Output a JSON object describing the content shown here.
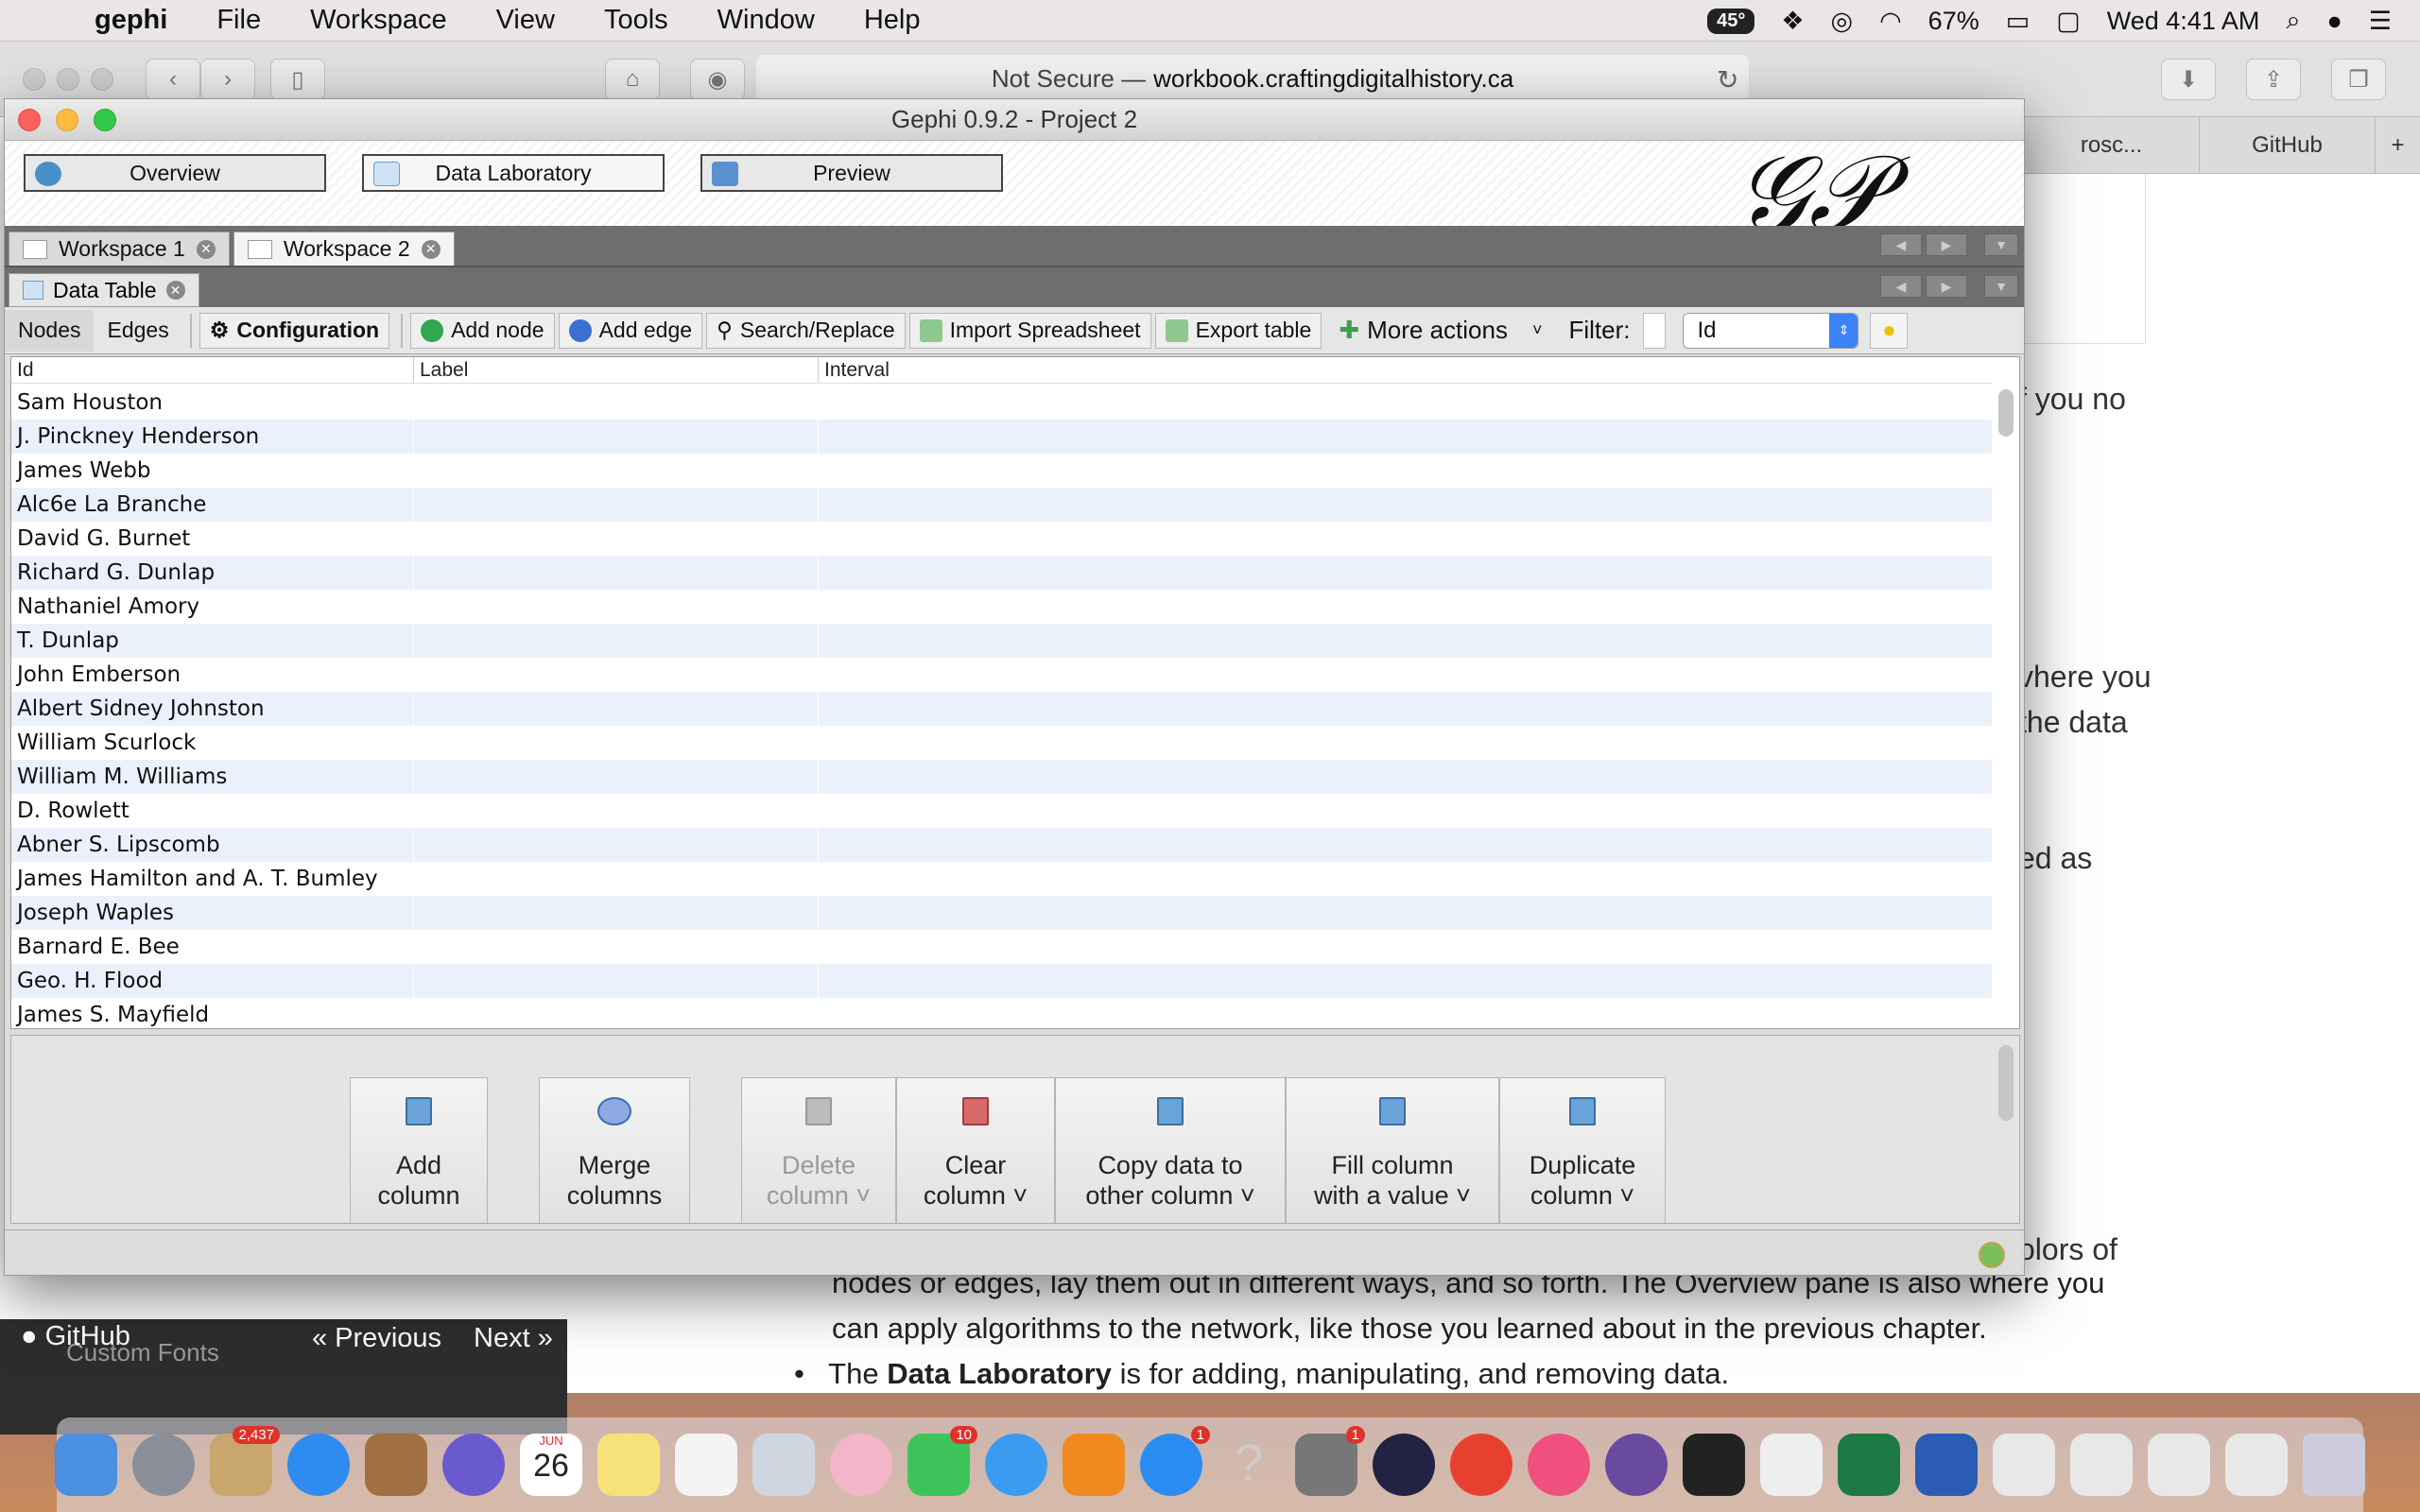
{
  "menubar": {
    "app": "gephi",
    "menus": [
      "File",
      "Workspace",
      "View",
      "Tools",
      "Window",
      "Help"
    ],
    "temperature": "45°",
    "battery": "67%",
    "clock": "Wed 4:41 AM"
  },
  "browser": {
    "security": "Not Secure —",
    "domain": "workbook.craftingdigitalhistory.ca",
    "tabs": [
      "rosc...",
      "GitHub"
    ],
    "side_text": [
      "f you no",
      "vhere you",
      "the data",
      "ed as",
      "olors of"
    ],
    "bottom_lines": [
      "nodes or edges, lay them out in different ways, and so forth. The Overview pane is also where you",
      "can apply algorithms to the network, like those you learned about in the previous chapter."
    ],
    "bullet_bold": "Data Laboratory",
    "bullet_prefix": "The",
    "bullet_rest": "is for adding, manipulating, and removing data.",
    "sidebar_partial": "Custom Fonts",
    "github_link": "GitHub",
    "prev": "« Previous",
    "next": "Next »"
  },
  "gephi": {
    "title": "Gephi 0.9.2 - Project 2",
    "perspectives": [
      "Overview",
      "Data Laboratory",
      "Preview"
    ],
    "workspaces": [
      "Workspace 1",
      "Workspace 2"
    ],
    "data_table_tab": "Data Table",
    "toolbar": {
      "nodes": "Nodes",
      "edges": "Edges",
      "configuration": "Configuration",
      "add_node": "Add node",
      "add_edge": "Add edge",
      "search_replace": "Search/Replace",
      "import_spreadsheet": "Import Spreadsheet",
      "export_table": "Export table",
      "more_actions": "More actions",
      "filter_label": "Filter:",
      "filter_column": "Id"
    },
    "columns": [
      "Id",
      "Label",
      "Interval"
    ],
    "rows": [
      "Sam Houston",
      "J. Pinckney Henderson",
      "James Webb",
      "Alc6e La Branche",
      "David G. Burnet",
      "Richard G. Dunlap",
      "Nathaniel Amory",
      "T. Dunlap",
      "John Emberson",
      "Albert Sidney Johnston",
      "William Scurlock",
      "William M. Williams",
      "D. Rowlett",
      "Abner S. Lipscomb",
      "James Hamilton and A. T. Bumley",
      "Joseph Waples",
      "Barnard E. Bee",
      "Geo. H. Flood",
      "James S. Mayfield"
    ],
    "column_actions": [
      {
        "line1": "Add",
        "line2": "column"
      },
      {
        "line1": "Merge",
        "line2": "columns"
      },
      {
        "line1": "Delete",
        "line2": "column ˅"
      },
      {
        "line1": "Clear",
        "line2": "column ˅"
      },
      {
        "line1": "Copy data to",
        "line2": "other column ˅"
      },
      {
        "line1": "Fill column",
        "line2": "with a value ˅"
      },
      {
        "line1": "Duplicate",
        "line2": "column ˅"
      }
    ]
  },
  "dock": {
    "mail_badge": "2,437",
    "calendar_month": "JUN",
    "calendar_day": "26",
    "facetime_badge": "10",
    "appstore_badge": "1",
    "prefs_badge": "1"
  }
}
